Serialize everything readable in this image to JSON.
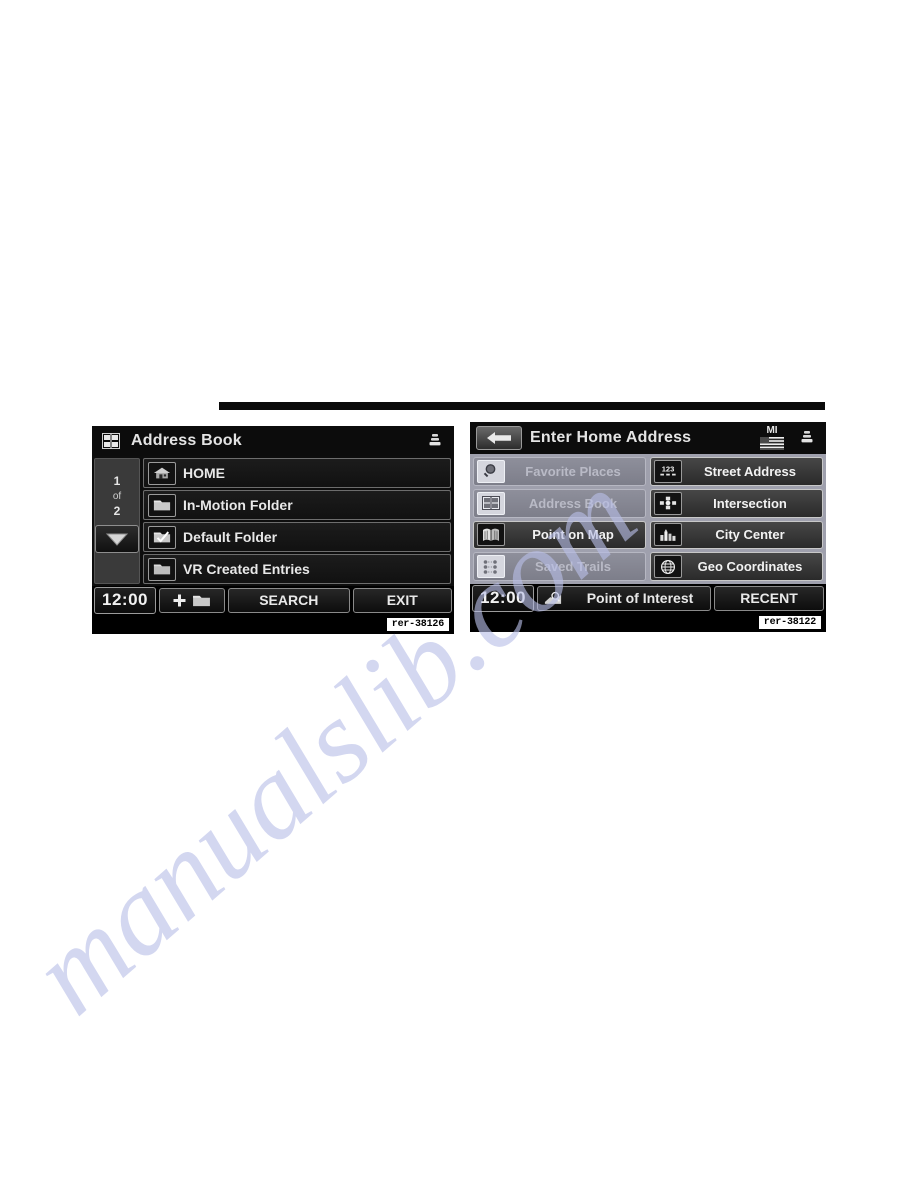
{
  "page": {
    "watermark": "manualslib.com"
  },
  "left_screen": {
    "caption": "rer-38126",
    "titlebar": {
      "title": "Address Book",
      "left_icon": "address-book-icon",
      "right_icon": "seat-stack-icon"
    },
    "pager": {
      "current": "1",
      "separator": "of",
      "total": "2",
      "down_icon": "chevron-down-icon"
    },
    "rows": [
      {
        "label": "HOME",
        "icon": "house-icon"
      },
      {
        "label": "In-Motion Folder",
        "icon": "folder-icon"
      },
      {
        "label": "Default Folder",
        "icon": "folder-check-icon"
      },
      {
        "label": "VR Created Entries",
        "icon": "folder-icon"
      }
    ],
    "bottombar": {
      "clock": "12:00",
      "new_folder_icon": "plus-folder-icon",
      "search_label": "SEARCH",
      "exit_label": "EXIT"
    }
  },
  "right_screen": {
    "caption": "rer-38122",
    "titlebar": {
      "back_icon": "back-arrow-icon",
      "title": "Enter Home Address",
      "state_code": "MI",
      "flag_icon": "us-flag-icon",
      "right_icon": "seat-stack-icon"
    },
    "grid": {
      "left_column": [
        {
          "label": "Favorite Places",
          "icon": "magnifier-icon",
          "enabled": false
        },
        {
          "label": "Address Book",
          "icon": "address-book-icon",
          "enabled": false
        },
        {
          "label": "Point on Map",
          "icon": "open-map-icon",
          "enabled": true
        },
        {
          "label": "Saved Trails",
          "icon": "trail-dots-icon",
          "enabled": false
        }
      ],
      "right_column": [
        {
          "label": "Street Address",
          "icon": "numbers-123-icon",
          "enabled": true
        },
        {
          "label": "Intersection",
          "icon": "crossroads-icon",
          "enabled": true
        },
        {
          "label": "City Center",
          "icon": "buildings-icon",
          "enabled": true
        },
        {
          "label": "Geo Coordinates",
          "icon": "globe-icon",
          "enabled": true
        }
      ]
    },
    "bottombar": {
      "clock": "12:00",
      "poi_icon": "map-search-icon",
      "poi_label": "Point of Interest",
      "recent_label": "RECENT"
    }
  }
}
